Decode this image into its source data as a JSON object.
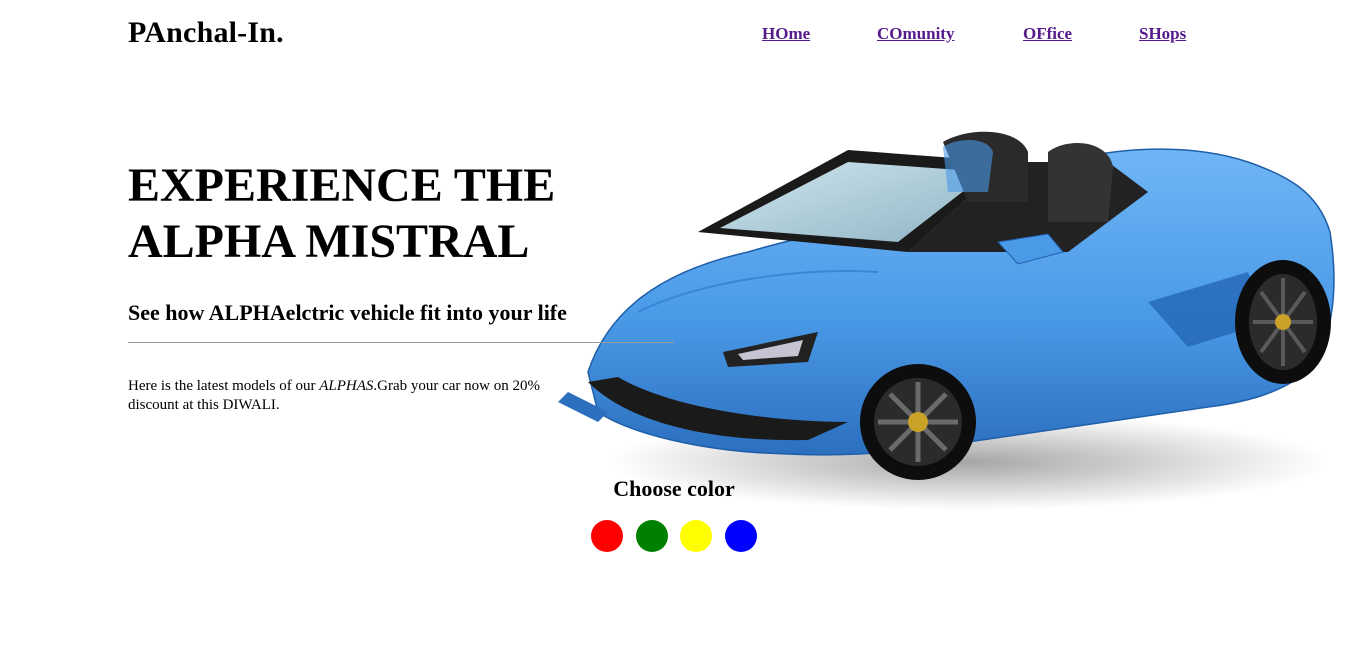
{
  "brand": "PAnchal-In.",
  "nav": [
    {
      "label": "HOme"
    },
    {
      "label": "COmunity"
    },
    {
      "label": "OFfice"
    },
    {
      "label": "SHops"
    }
  ],
  "hero": {
    "title_line1": "EXPERIENCE THE",
    "title_line2": "ALPHA MISTRAL",
    "subtitle": "See how ALPHAelctric vehicle fit into your life",
    "desc_before": "Here is the latest models of our ",
    "desc_italic": "ALPHAS",
    "desc_after": ".Grab your car now on 20% discount at this DIWALI."
  },
  "color_picker": {
    "title": "Choose color",
    "options": [
      "#ff0000",
      "#008000",
      "#ffff00",
      "#0000ff"
    ]
  },
  "car_image": {
    "icon": "blue-convertible-sports-car",
    "body_color": "#4a9ae8"
  }
}
